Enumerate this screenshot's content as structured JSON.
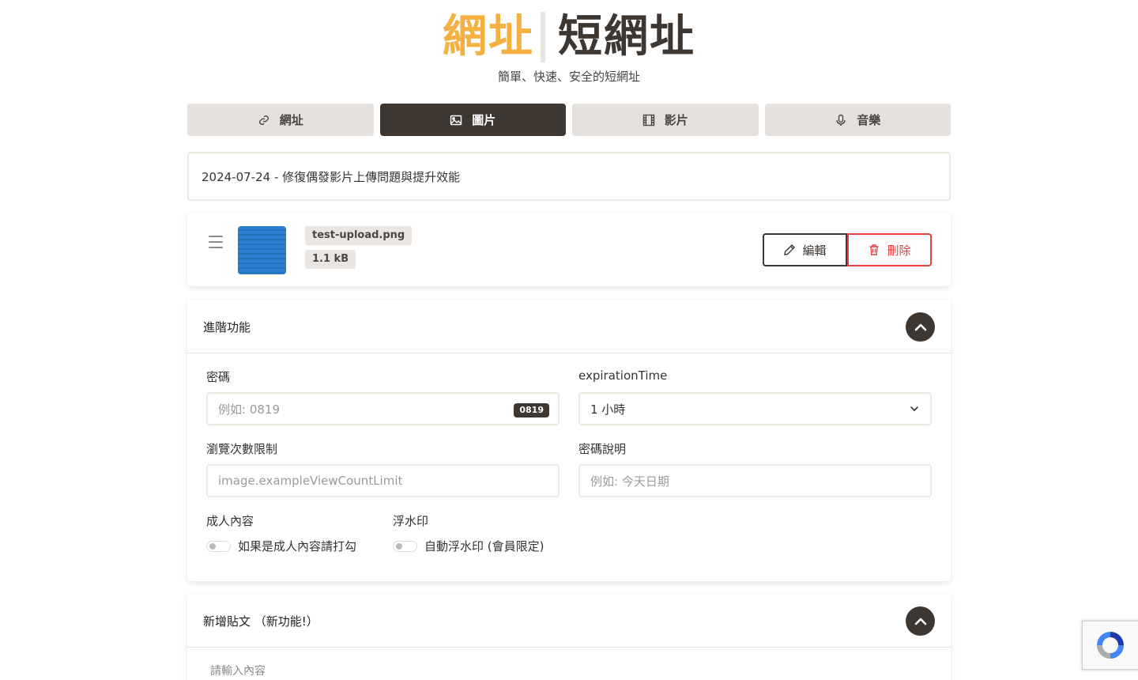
{
  "logo": {
    "main": "網址",
    "sub": "短網址"
  },
  "tagline": "簡單、快速、安全的短網址",
  "tabs": [
    {
      "label": "網址",
      "icon": "link-icon",
      "active": false
    },
    {
      "label": "圖片",
      "icon": "image-icon",
      "active": true
    },
    {
      "label": "影片",
      "icon": "film-icon",
      "active": false
    },
    {
      "label": "音樂",
      "icon": "microphone-icon",
      "active": false
    }
  ],
  "notice": "2024-07-24 - 修復偶發影片上傳問題與提升效能",
  "file": {
    "name": "test-upload.png",
    "size": "1.1 kB",
    "edit_label": "編輯",
    "delete_label": "刪除"
  },
  "advanced": {
    "title": "進階功能",
    "password": {
      "label": "密碼",
      "placeholder": "例如: 0819",
      "badge": "0819"
    },
    "expiration": {
      "label": "expirationTime",
      "value": "1 小時"
    },
    "view_limit": {
      "label": "瀏覽次數限制",
      "placeholder": "image.exampleViewCountLimit"
    },
    "password_hint": {
      "label": "密碼說明",
      "placeholder": "例如: 今天日期"
    },
    "adult": {
      "label": "成人內容",
      "switch_text": "如果是成人內容請打勾",
      "checked": false
    },
    "watermark": {
      "label": "浮水印",
      "switch_text": "自動浮水印 (會員限定)",
      "checked": false
    }
  },
  "post": {
    "title": "新增貼文 （新功能!）",
    "placeholder": "請輸入內容"
  },
  "colors": {
    "accent": "#f5b042",
    "dark": "#3d3631",
    "danger": "#e04444",
    "tab_bg": "#e6e1dc"
  }
}
